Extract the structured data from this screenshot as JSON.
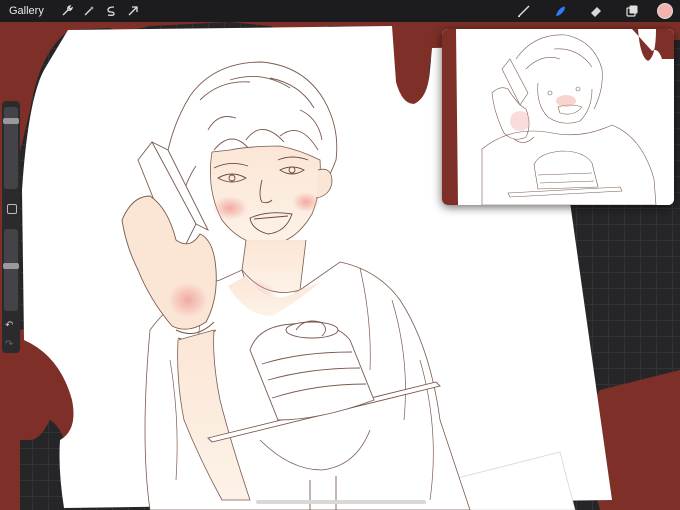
{
  "toolbar": {
    "gallery_label": "Gallery",
    "left_icons": [
      "wrench-icon",
      "magic-wand-icon",
      "selection-icon",
      "transform-arrow-icon"
    ],
    "right_icons": [
      "brush-icon",
      "smudge-icon",
      "eraser-icon",
      "layers-icon"
    ],
    "current_color": "#f2b4ac"
  },
  "sidebar": {
    "brush_size_level": 0.15,
    "opacity_level": 0.45
  },
  "colors": {
    "drip": "#7e3028",
    "canvas_paper": "#ffffff",
    "skin_blush": "#f4b8b0",
    "skin_light": "#fbe8d8",
    "line_art": "#7a5a4e"
  }
}
